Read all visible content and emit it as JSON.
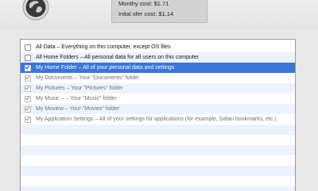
{
  "header": {
    "monthly_cost": "Monthy cost: $1.71",
    "initial_cost": "Inital xfer cost: $1.14"
  },
  "backup_list": {
    "items": [
      {
        "label": "All Data – Everything on this computer, except OS files",
        "checked": false,
        "enabled": true
      },
      {
        "label": "All Home Folders – All personal data for all users on this computer",
        "checked": false,
        "enabled": true
      },
      {
        "label": "My Home Folder – All of your personal data and settings",
        "checked": true,
        "enabled": true,
        "selected": true
      },
      {
        "label": "My Documents – Your \"Documents\" folder",
        "checked": true,
        "enabled": false
      },
      {
        "label": "My Pictures – Your \"Pictures\" folder",
        "checked": true,
        "enabled": false
      },
      {
        "label": "My Music – – Your \"Music\" folder",
        "checked": true,
        "enabled": false
      },
      {
        "label": "My Moview – Your \"Movies\" folder",
        "checked": true,
        "enabled": false
      },
      {
        "label": "My Application Settings – All of your settings for applications (for example, Safari bookmarks, etc.)",
        "checked": true,
        "enabled": false
      }
    ]
  },
  "colors": {
    "selection": "#3b76d8",
    "alternate_row": "#edf3fe"
  },
  "icons": {
    "app_logo": "globe-icon"
  }
}
